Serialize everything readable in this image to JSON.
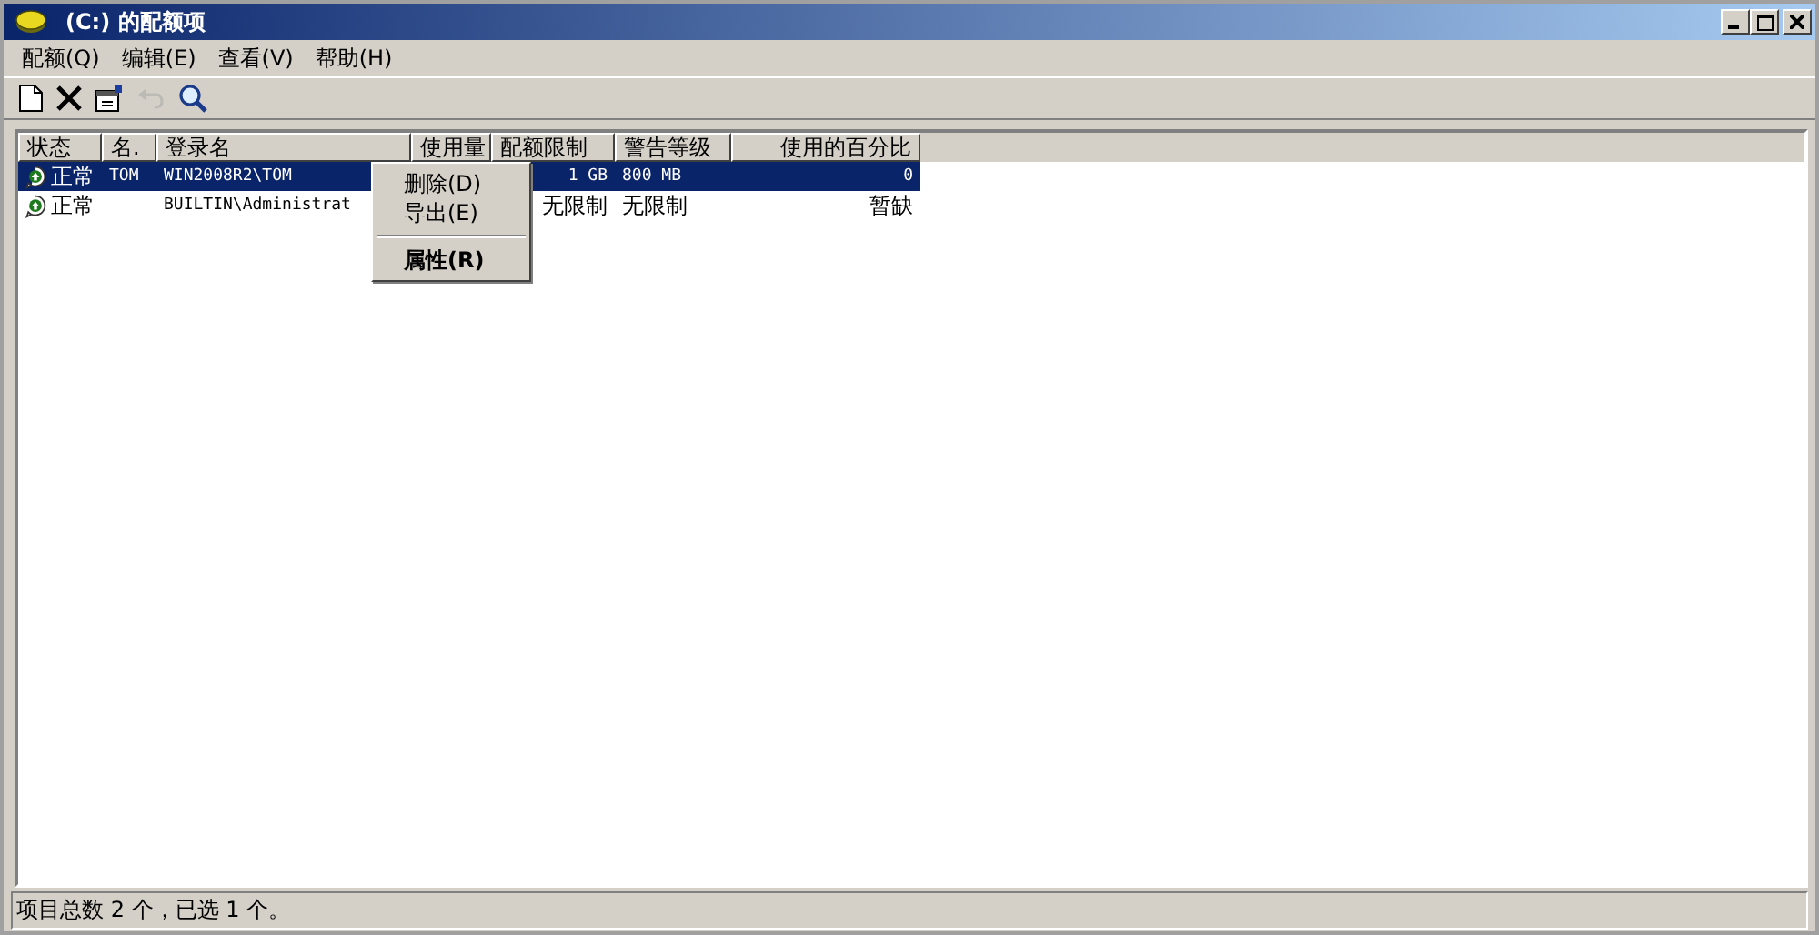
{
  "window": {
    "title": "(C:) 的配额项"
  },
  "menu_bar": [
    "配额(Q)",
    "编辑(E)",
    "查看(V)",
    "帮助(H)"
  ],
  "toolbar": [
    {
      "kind": "new",
      "disabled": false
    },
    {
      "kind": "delete",
      "disabled": false
    },
    {
      "kind": "properties",
      "disabled": false
    },
    {
      "kind": "undo",
      "disabled": true
    },
    {
      "kind": "find",
      "disabled": false
    }
  ],
  "table": {
    "columns": [
      "状态",
      "名.",
      "登录名",
      "使用量",
      "配额限制",
      "警告等级",
      "使用的百分比"
    ],
    "rows": [
      {
        "selected": true,
        "cells": [
          "正常",
          "TOM",
          "WIN2008R2\\TOM",
          "",
          "1 GB",
          "800 MB",
          "0"
        ]
      },
      {
        "selected": false,
        "cells": [
          "正常",
          "",
          "BUILTIN\\Administrat",
          "",
          "无限制",
          "无限制",
          "暂缺"
        ]
      }
    ]
  },
  "context_menu": {
    "items": [
      {
        "kind": "item",
        "label": "删除(D)",
        "default": false
      },
      {
        "kind": "item",
        "label": "导出(E)",
        "default": false
      },
      {
        "kind": "separator"
      },
      {
        "kind": "item",
        "label": "属性(R)",
        "default": true
      }
    ]
  },
  "status_bar": "项目总数 2 个，已选 1 个。"
}
